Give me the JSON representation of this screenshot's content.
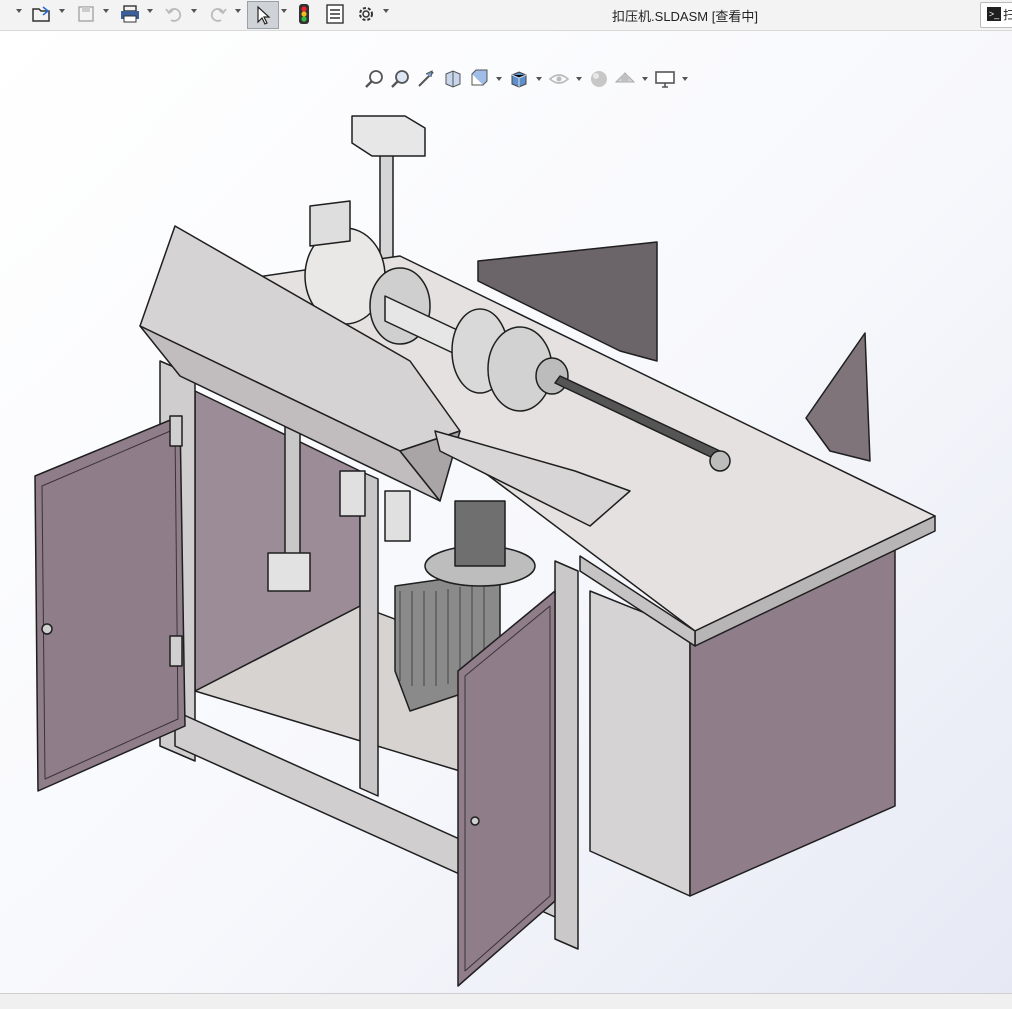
{
  "window": {
    "title": "扣压机.SLDASM [查看中]"
  },
  "command_search": {
    "prompt_glyph": ">_",
    "text": "扫"
  },
  "toolbar": {
    "items": [
      {
        "name": "new-document",
        "has_dropdown": true
      },
      {
        "name": "open-file",
        "has_dropdown": true
      },
      {
        "name": "save",
        "has_dropdown": true
      },
      {
        "name": "print",
        "has_dropdown": true
      },
      {
        "name": "undo",
        "has_dropdown": true
      },
      {
        "name": "redo",
        "has_dropdown": true
      },
      {
        "name": "select",
        "has_dropdown": true
      },
      {
        "name": "rebuild"
      },
      {
        "name": "file-properties"
      },
      {
        "name": "options",
        "has_dropdown": true
      }
    ]
  },
  "heads_up_toolbar": {
    "items": [
      "zoom-to-fit",
      "zoom-to-area",
      "previous-view",
      "section-view",
      "view-orientation",
      "display-style",
      "hide-show-items",
      "edit-appearance",
      "apply-scene",
      "view-settings"
    ]
  },
  "colors": {
    "cabinet_panel": "#8f7d8a",
    "panel_light": "#d8d4d6",
    "frame": "#c9c7c8",
    "edge": "#1f1f1f"
  }
}
